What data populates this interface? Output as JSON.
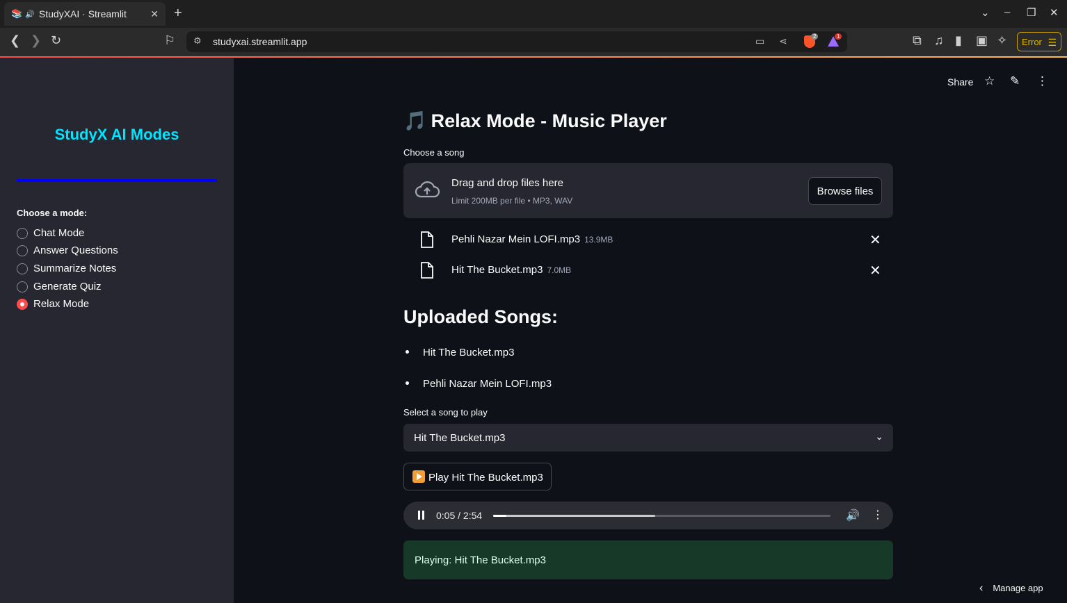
{
  "browser": {
    "tab_title": "StudyXAI · Streamlit",
    "tab_favicon": "📚",
    "tab_audio_icon": "🔊",
    "url": "studyxai.streamlit.app",
    "error_label": "Error",
    "brave_badge": "2",
    "rewards_badge": "1"
  },
  "sidebar": {
    "title": "StudyX AI Modes",
    "rule_color": "#0000ff",
    "mode_label": "Choose a mode:",
    "modes": [
      "Chat Mode",
      "Answer Questions",
      "Summarize Notes",
      "Generate Quiz",
      "Relax Mode"
    ],
    "selected_mode": "Relax Mode"
  },
  "header": {
    "share_label": "Share"
  },
  "main": {
    "title_icon": "🎵",
    "title": "Relax Mode - Music Player",
    "uploader_label": "Choose a song",
    "drop_text": "Drag and drop files here",
    "drop_limit": "Limit 200MB per file • MP3, WAV",
    "browse_label": "Browse files",
    "files": [
      {
        "name": "Pehli Nazar Mein LOFI.mp3",
        "size": "13.9MB"
      },
      {
        "name": "Hit The Bucket.mp3",
        "size": "7.0MB"
      }
    ],
    "uploaded_heading": "Uploaded Songs:",
    "uploaded_list": [
      "Hit The Bucket.mp3",
      "Pehli Nazar Mein LOFI.mp3"
    ],
    "select_label": "Select a song to play",
    "select_value": "Hit The Bucket.mp3",
    "play_button": "Play Hit The Bucket.mp3",
    "audio": {
      "time": "0:05 / 2:54",
      "played_fraction": 0.04,
      "buffered_fraction": 0.48
    },
    "status": "Playing: Hit The Bucket.mp3",
    "manage_app": "Manage app"
  }
}
